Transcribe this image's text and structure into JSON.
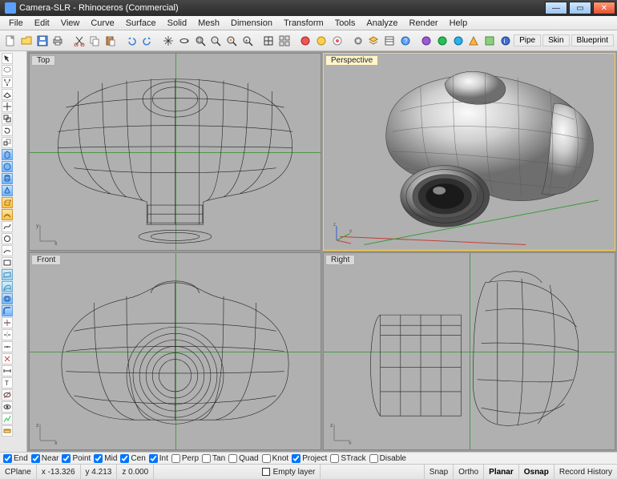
{
  "title": "Camera-SLR - Rhinoceros (Commercial)",
  "menu": [
    "File",
    "Edit",
    "View",
    "Curve",
    "Surface",
    "Solid",
    "Mesh",
    "Dimension",
    "Transform",
    "Tools",
    "Analyze",
    "Render",
    "Help"
  ],
  "right_tabs": [
    "Pipe",
    "Skin",
    "Blueprint"
  ],
  "viewports": {
    "top_left": "Top",
    "top_right": "Perspective",
    "bottom_left": "Front",
    "bottom_right": "Right"
  },
  "osnap": {
    "End": true,
    "Near": true,
    "Point": true,
    "Mid": true,
    "Cen": true,
    "Int": true,
    "Perp": false,
    "Tan": false,
    "Quad": false,
    "Knot": false,
    "Project": true,
    "STrack": false,
    "Disable": false
  },
  "status": {
    "cplane": "CPlane",
    "x": "x -13.326",
    "y": "y 4.213",
    "z": "z 0.000",
    "layer": "Empty layer",
    "toggles": [
      "Snap",
      "Ortho",
      "Planar",
      "Osnap",
      "Record History"
    ],
    "active_toggles": [
      "Planar",
      "Osnap"
    ]
  },
  "toolbar_icons": [
    "new",
    "open",
    "save",
    "print",
    "",
    "cut",
    "copy",
    "paste",
    "",
    "undo",
    "redo",
    "",
    "pan",
    "rotate-view",
    "zoom-window",
    "zoom-extents",
    "zoom-selected",
    "zoom-dynamic",
    "",
    "set-view",
    "four-view",
    "",
    "shade",
    "render",
    "render-preview",
    "",
    "options",
    "layers",
    "properties",
    "help",
    "",
    "debug1",
    "debug2",
    "debug3",
    "macro",
    "plugin",
    "update",
    "info"
  ],
  "sidebar_icons": [
    "pointer",
    "lasso",
    "",
    "move",
    "rotate",
    "scale",
    "",
    "box",
    "sphere",
    "cylinder",
    "cone",
    "",
    "nurbs-curve",
    "interp-curve",
    "circle",
    "arc",
    "",
    "nurbs-surface",
    "loft",
    "sweep",
    "revolve",
    "",
    "fillet",
    "chamfer",
    "trim",
    "split",
    "",
    "layer-on",
    "layer-off",
    "hide",
    "show",
    "",
    "dim-linear",
    "dim-radial",
    "text",
    "",
    "analysis",
    "measure"
  ]
}
